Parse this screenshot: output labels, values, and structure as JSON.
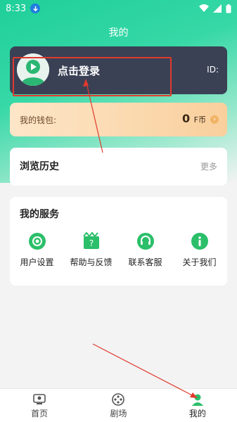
{
  "status_bar": {
    "time": "8:33"
  },
  "header": {
    "title": "我的"
  },
  "login_card": {
    "login_text": "点击登录",
    "id_label": "ID:"
  },
  "wallet": {
    "label": "我的钱包:",
    "amount": "0",
    "unit": "F币"
  },
  "history": {
    "title": "浏览历史",
    "more": "更多"
  },
  "services": {
    "title": "我的服务",
    "items": [
      {
        "label": "用户设置",
        "icon": "settings-icon"
      },
      {
        "label": "帮助与反馈",
        "icon": "help-icon"
      },
      {
        "label": "联系客服",
        "icon": "headset-icon"
      },
      {
        "label": "关于我们",
        "icon": "info-icon"
      }
    ]
  },
  "tabbar": {
    "items": [
      {
        "label": "首页",
        "icon": "home-icon"
      },
      {
        "label": "剧场",
        "icon": "film-reel-icon"
      },
      {
        "label": "我的",
        "icon": "profile-icon",
        "active": true
      }
    ]
  },
  "colors": {
    "accent": "#1fcf9a",
    "card_dark": "#3a4155",
    "annotation": "#e03a2e"
  }
}
